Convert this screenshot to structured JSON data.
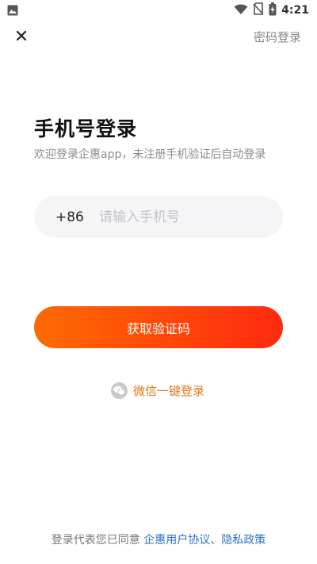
{
  "status_bar": {
    "time": "4:21",
    "icons": [
      "image-icon",
      "wifi-icon",
      "no-sim-icon",
      "battery-charging-icon"
    ]
  },
  "top_bar": {
    "close_icon": "close-icon",
    "password_login_label": "密码登录"
  },
  "header": {
    "title": "手机号登录",
    "subtitle": "欢迎登录企惠app，未注册手机验证后自动登录"
  },
  "phone_form": {
    "country_code": "+86",
    "phone_value": "",
    "phone_placeholder": "请输入手机号",
    "submit_label": "获取验证码"
  },
  "wechat": {
    "icon": "wechat-icon",
    "label": "微信一键登录"
  },
  "agreement": {
    "prefix": "登录代表您已同意 ",
    "user_agreement": "企惠用户协议",
    "separator": "、",
    "privacy_policy": "隐私政策"
  },
  "colors": {
    "primary_gradient_start": "#ff6a00",
    "primary_gradient_end": "#ff2a10",
    "wechat_text": "#e8761c",
    "link": "#2b71c8",
    "input_bg": "#f5f5f7"
  }
}
